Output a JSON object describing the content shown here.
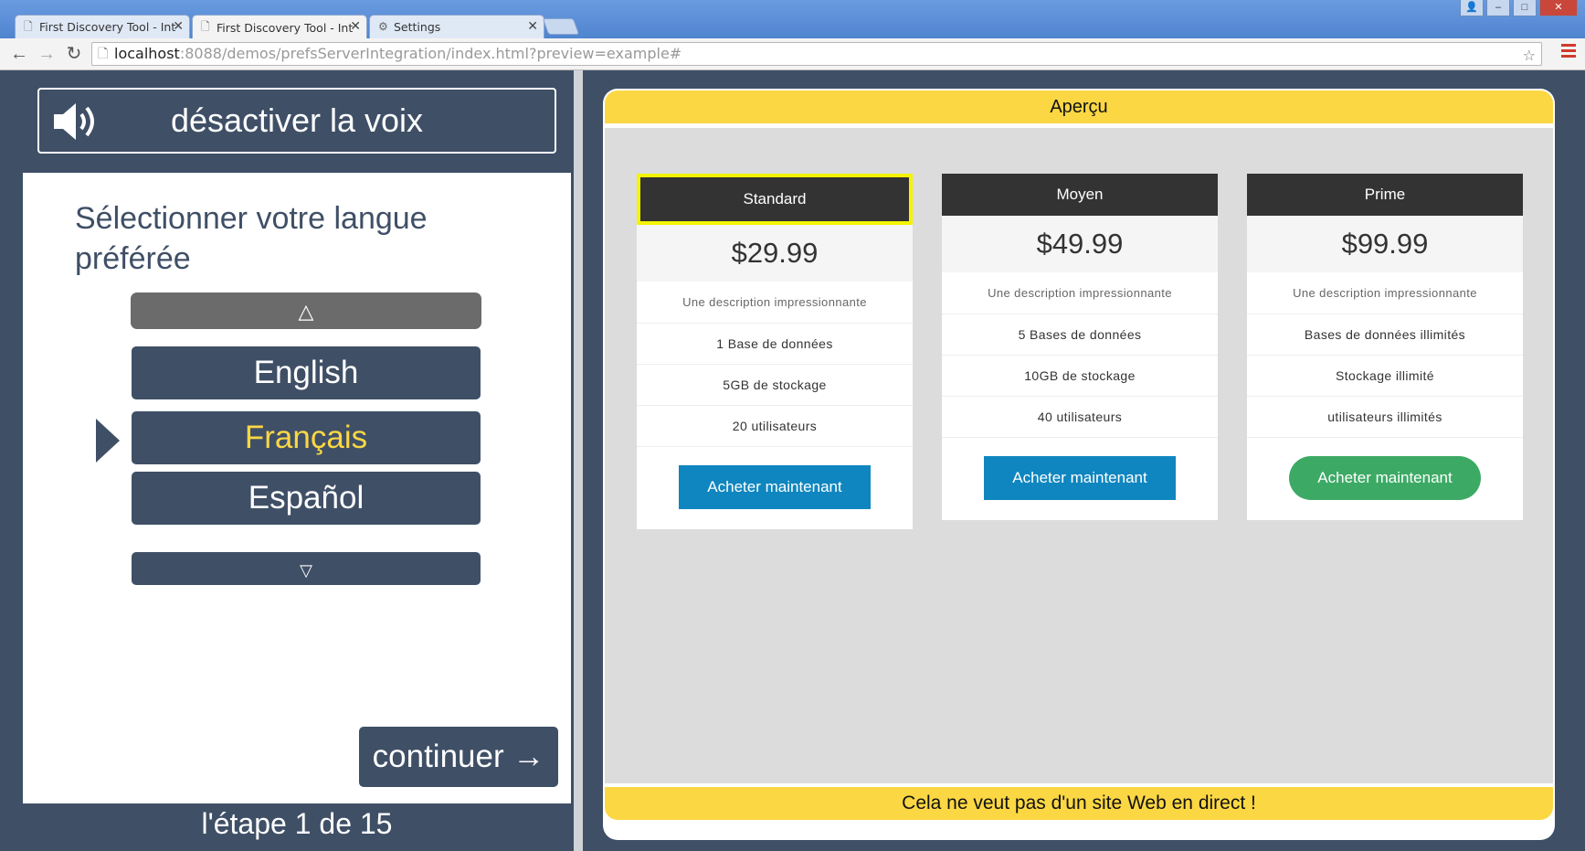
{
  "browser": {
    "tabs": [
      {
        "label": "First Discovery Tool - Integ",
        "icon": "page-icon"
      },
      {
        "label": "First Discovery Tool - Integ",
        "icon": "page-icon"
      },
      {
        "label": "Settings",
        "icon": "gear-icon"
      }
    ],
    "url_host": "localhost",
    "url_rest": ":8088/demos/prefsServerIntegration/index.html?preview=example#"
  },
  "tool": {
    "voice_label": "désactiver la voix",
    "prompt": "Sélectionner votre langue préférée",
    "scroll_up": "△",
    "scroll_down": "▽",
    "languages": [
      "English",
      "Français",
      "Español"
    ],
    "selected_language": "Français",
    "continue_label": "continuer →",
    "step": "l'étape 1 de 15"
  },
  "preview": {
    "header": "Aperçu",
    "footer": "Cela ne veut pas d'un site Web en direct !",
    "cards": [
      {
        "name": "Standard",
        "price": "$29.99",
        "description": "Une description impressionnante",
        "features": [
          "1 Base de données",
          "5GB de stockage",
          "20 utilisateurs"
        ],
        "button": "Acheter maintenant"
      },
      {
        "name": "Moyen",
        "price": "$49.99",
        "description": "Une description impressionnante",
        "features": [
          "5 Bases de données",
          "10GB de stockage",
          "40 utilisateurs"
        ],
        "button": "Acheter maintenant"
      },
      {
        "name": "Prime",
        "price": "$99.99",
        "description": "Une description impressionnante",
        "features": [
          "Bases de données illimités",
          "Stockage illimité",
          "utilisateurs illimités"
        ],
        "button": "Acheter maintenant"
      }
    ]
  },
  "colors": {
    "panel": "#3f4f66",
    "accent_yellow": "#fbd744",
    "buy_blue": "#0f86bf",
    "buy_green": "#3caa65"
  }
}
